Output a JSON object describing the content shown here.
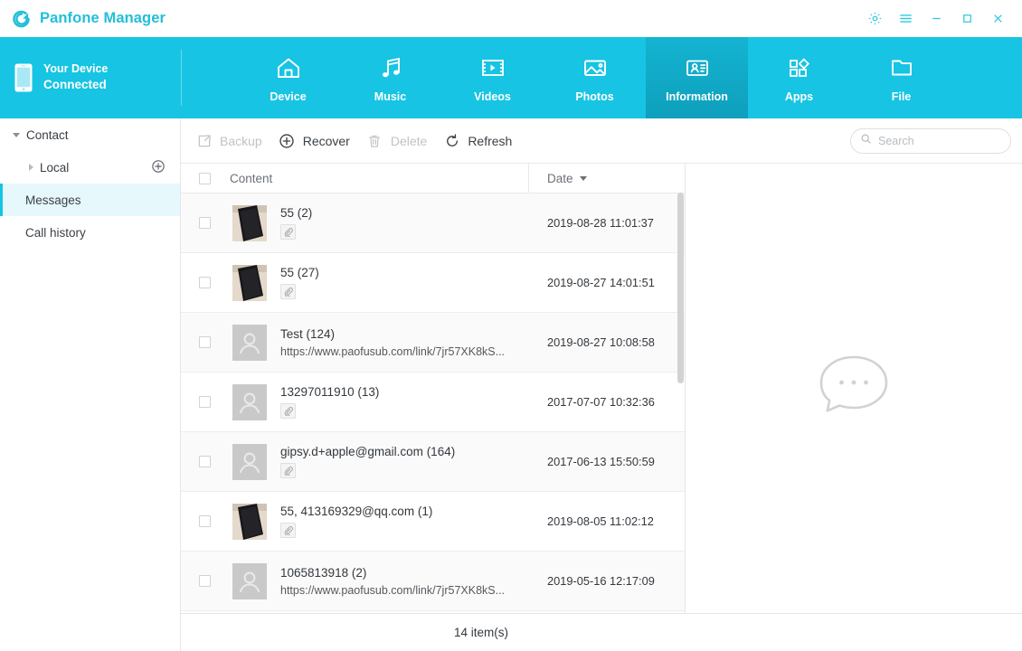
{
  "window": {
    "app_title": "Panfone Manager",
    "logo_icon": "panfone-logo-icon",
    "controls": [
      {
        "name": "settings-button",
        "icon": "gear-icon"
      },
      {
        "name": "menu-button",
        "icon": "hamburger-menu-icon"
      },
      {
        "name": "minimize-button",
        "icon": "minimize-icon"
      },
      {
        "name": "maximize-button",
        "icon": "maximize-icon"
      },
      {
        "name": "close-button",
        "icon": "close-icon"
      }
    ]
  },
  "device": {
    "icon": "phone-icon",
    "label": "Your Device",
    "status": "Connected"
  },
  "nav": {
    "tabs": [
      {
        "label": "Device",
        "icon": "home-icon",
        "active": false
      },
      {
        "label": "Music",
        "icon": "music-note-icon",
        "active": false
      },
      {
        "label": "Videos",
        "icon": "film-play-icon",
        "active": false
      },
      {
        "label": "Photos",
        "icon": "picture-icon",
        "active": false
      },
      {
        "label": "Information",
        "icon": "contact-card-icon",
        "active": true
      },
      {
        "label": "Apps",
        "icon": "apps-grid-icon",
        "active": false
      },
      {
        "label": "File",
        "icon": "folder-icon",
        "active": false
      }
    ]
  },
  "sidebar": {
    "items": [
      {
        "label": "Contact",
        "level": 0,
        "expanded": true,
        "selected": false,
        "has_add": false
      },
      {
        "label": "Local",
        "level": 1,
        "expanded": false,
        "selected": false,
        "has_add": true,
        "add_icon": "plus-circle-icon"
      },
      {
        "label": "Messages",
        "level": 0,
        "plain": true,
        "selected": true,
        "has_add": false
      },
      {
        "label": "Call history",
        "level": 0,
        "plain": true,
        "selected": false,
        "has_add": false
      }
    ]
  },
  "toolbar": {
    "buttons": [
      {
        "label": "Backup",
        "icon": "export-box-icon",
        "enabled": false
      },
      {
        "label": "Recover",
        "icon": "plus-circle-icon",
        "enabled": true
      },
      {
        "label": "Delete",
        "icon": "trash-icon",
        "enabled": false
      },
      {
        "label": "Refresh",
        "icon": "refresh-icon",
        "enabled": true
      }
    ],
    "search": {
      "icon": "search-icon",
      "placeholder": "Search",
      "value": ""
    }
  },
  "table": {
    "headers": {
      "select_all": "",
      "content": "Content",
      "date": "Date",
      "sort_icon": "caret-down-icon"
    },
    "rows": [
      {
        "avatar": "photo",
        "name": "55",
        "count": "(2)",
        "sub": "",
        "attachment": true,
        "date": "2019-08-28 11:01:37",
        "checked": false
      },
      {
        "avatar": "photo",
        "name": "55",
        "count": "(27)",
        "sub": "",
        "attachment": true,
        "date": "2019-08-27 14:01:51",
        "checked": false
      },
      {
        "avatar": "person",
        "name": "Test",
        "count": "(124)",
        "sub": "https://www.paofusub.com/link/7jr57XK8kS...",
        "attachment": false,
        "date": "2019-08-27 10:08:58",
        "checked": false
      },
      {
        "avatar": "person",
        "name": "13297011910",
        "count": "(13)",
        "sub": "",
        "attachment": true,
        "date": "2017-07-07 10:32:36",
        "checked": false
      },
      {
        "avatar": "person",
        "name": "gipsy.d+apple@gmail.com",
        "count": "(164)",
        "sub": "",
        "attachment": true,
        "date": "2017-06-13 15:50:59",
        "checked": false
      },
      {
        "avatar": "photo",
        "name": "55, 413169329@qq.com",
        "count": "(1)",
        "sub": "",
        "attachment": true,
        "date": "2019-08-05 11:02:12",
        "checked": false
      },
      {
        "avatar": "person",
        "name": "1065813918",
        "count": "(2)",
        "sub": "https://www.paofusub.com/link/7jr57XK8kS...",
        "attachment": false,
        "date": "2019-05-16 12:17:09",
        "checked": false
      }
    ]
  },
  "preview": {
    "placeholder_icon": "speech-bubble-icon"
  },
  "status": {
    "item_count": "14 item(s)"
  },
  "colors": {
    "brand_cyan": "#17c4e3",
    "brand_cyan_dark": "#0e9fbc",
    "logo_teal": "#21bfd8",
    "selected_row": "#e6f8fc",
    "text_primary": "#33383d",
    "text_muted": "#6b7075",
    "disabled": "#bfc3c7"
  }
}
